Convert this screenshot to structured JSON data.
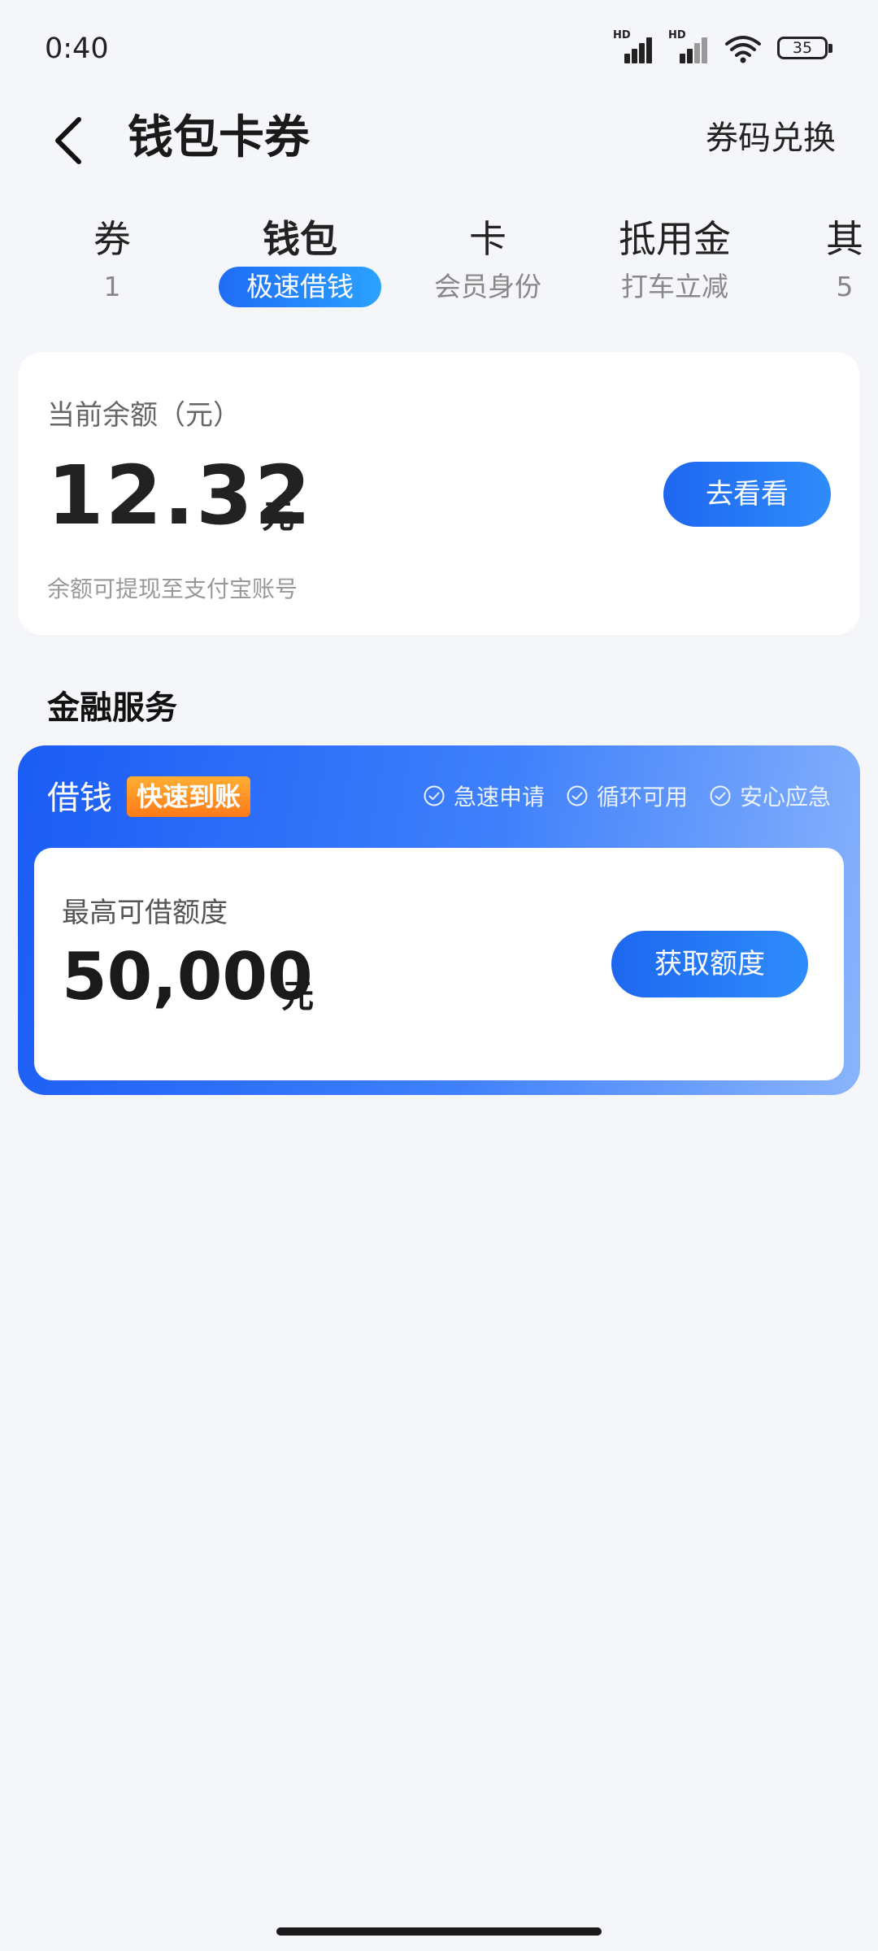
{
  "status_bar": {
    "time": "0:40",
    "hd_label": "HD",
    "battery": "35"
  },
  "header": {
    "title": "钱包卡券",
    "action": "券码兑换"
  },
  "tabs": [
    {
      "label": "券",
      "sub": "1"
    },
    {
      "label": "钱包",
      "sub": "极速借钱"
    },
    {
      "label": "卡",
      "sub": "会员身份"
    },
    {
      "label": "抵用金",
      "sub": "打车立减"
    },
    {
      "label": "其",
      "sub": "5"
    }
  ],
  "balance": {
    "label": "当前余额（元）",
    "amount": "12.32",
    "unit": "元",
    "note": "余额可提现至支付宝账号",
    "button": "去看看"
  },
  "section_title": "金融服务",
  "loan": {
    "title": "借钱",
    "badge": "快速到账",
    "features": [
      "急速申请",
      "循环可用",
      "安心应急"
    ],
    "label": "最高可借额度",
    "amount": "50,000",
    "unit": "元",
    "button": "获取额度"
  },
  "colors": {
    "accent": "#1d67f0",
    "badge": "#ff8a1f",
    "background": "#f4f6f9"
  }
}
